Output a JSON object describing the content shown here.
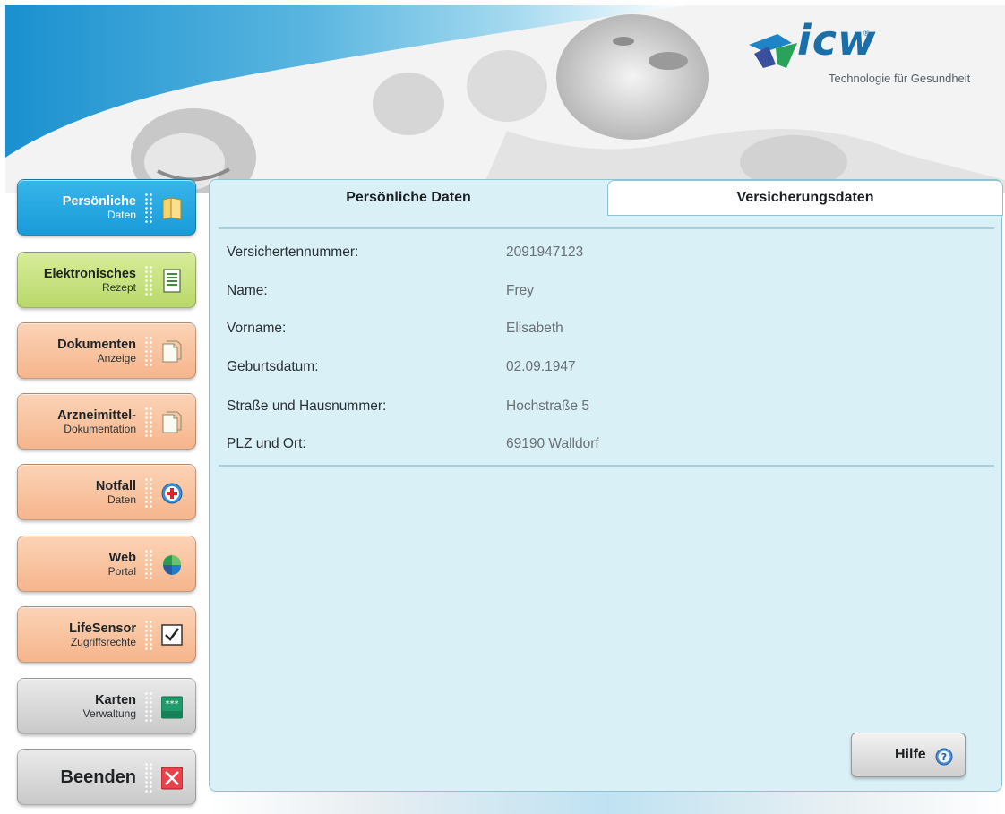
{
  "brand": {
    "logo_word": "icw",
    "logo_reg": "®",
    "tagline": "Technologie für Gesundheit"
  },
  "sidebar": {
    "items": [
      {
        "main": "Persönliche",
        "sub": "Daten",
        "icon": "book-icon"
      },
      {
        "main": "Elektronisches",
        "sub": "Rezept",
        "icon": "prescription-document-icon"
      },
      {
        "main": "Dokumenten",
        "sub": "Anzeige",
        "icon": "documents-icon"
      },
      {
        "main": "Arzneimittel-",
        "sub": "Dokumentation",
        "icon": "documents-icon"
      },
      {
        "main": "Notfall",
        "sub": "Daten",
        "icon": "emergency-cross-icon"
      },
      {
        "main": "Web",
        "sub": "Portal",
        "icon": "web-portal-icon"
      },
      {
        "main": "LifeSensor",
        "sub": "Zugriffsrechte",
        "icon": "checkbox-icon"
      },
      {
        "main": "Karten",
        "sub": "Verwaltung",
        "icon": "card-icon"
      },
      {
        "main": "Beenden",
        "sub": "",
        "icon": "close-icon"
      }
    ]
  },
  "tabs": {
    "persoenliche": "Persönliche Daten",
    "versicherung": "Versicherungsdaten"
  },
  "fields": [
    {
      "label": "Versichertennummer:",
      "value": "2091947123"
    },
    {
      "label": "Name:",
      "value": "Frey"
    },
    {
      "label": "Vorname:",
      "value": "Elisabeth"
    },
    {
      "label": "Geburtsdatum:",
      "value": "02.09.1947"
    },
    {
      "label": "Straße und Hausnummer:",
      "value": "Hochstraße 5"
    },
    {
      "label": "PLZ und Ort:",
      "value": "69190 Walldorf"
    }
  ],
  "help": {
    "label": "Hilfe"
  },
  "colors": {
    "panel_bg": "#daf0f7",
    "active_nav": "#1a9bd8",
    "nav_orange": "#f6b58c",
    "nav_green": "#b9d96a",
    "nav_grey": "#c9c9c9",
    "logo_blue": "#1a6fa8"
  }
}
